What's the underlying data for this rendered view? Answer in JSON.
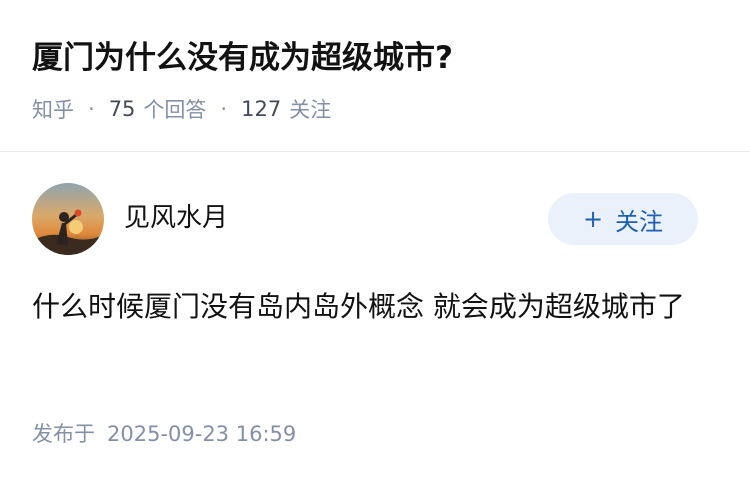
{
  "question": {
    "title": "厦门为什么没有成为超级城市?",
    "source": "知乎",
    "answer_count": "75",
    "answer_label": "个回答",
    "follower_count": "127",
    "follower_label": "关注",
    "separator": "·"
  },
  "answer": {
    "author": {
      "name": "见风水月",
      "avatar_icon": "avatar-photo-icon"
    },
    "follow_button": {
      "plus": "+",
      "label": "关注"
    },
    "content": "什么时候厦门没有岛内岛外概念 就会成为超级城市了",
    "publish_label": "发布于",
    "publish_time": "2025-09-23 16:59"
  },
  "colors": {
    "title": "#121212",
    "meta": "#8590a6",
    "follow_bg": "#ebf1fa",
    "follow_text": "#1e5fb4",
    "divider": "#ebebeb"
  }
}
